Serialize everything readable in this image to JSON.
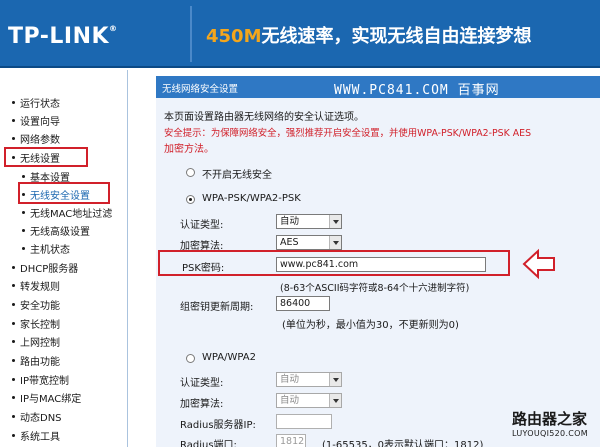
{
  "header": {
    "logo": "TP-LINK",
    "logo_reg": "®",
    "slogan_highlight": "450M",
    "slogan_text": "无线速率，实现无线自由连接梦想"
  },
  "sidebar": {
    "items": [
      {
        "label": "运行状态"
      },
      {
        "label": "设置向导"
      },
      {
        "label": "网络参数"
      },
      {
        "label": "无线设置"
      },
      {
        "label": "基本设置"
      },
      {
        "label": "无线安全设置"
      },
      {
        "label": "无线MAC地址过滤"
      },
      {
        "label": "无线高级设置"
      },
      {
        "label": "主机状态"
      },
      {
        "label": "DHCP服务器"
      },
      {
        "label": "转发规则"
      },
      {
        "label": "安全功能"
      },
      {
        "label": "家长控制"
      },
      {
        "label": "上网控制"
      },
      {
        "label": "路由功能"
      },
      {
        "label": "IP带宽控制"
      },
      {
        "label": "IP与MAC绑定"
      },
      {
        "label": "动态DNS"
      },
      {
        "label": "系统工具"
      }
    ]
  },
  "main": {
    "title": "无线网络安全设置",
    "watermark": "WWW.PC841.COM 百事网",
    "intro": "本页面设置路由器无线网络的安全认证选项。",
    "tip_line1": "安全提示：为保障网络安全，强烈推荐开启安全设置，并使用WPA-PSK/WPA2-PSK AES",
    "tip_line2": "加密方法。",
    "opt_disable": "不开启无线安全",
    "opt_wpapsk": "WPA-PSK/WPA2-PSK",
    "auth_label": "认证类型:",
    "auth_value": "自动",
    "cipher_label": "加密算法:",
    "cipher_value": "AES",
    "psk_label": "PSK密码:",
    "psk_value": "www.pc841.com",
    "psk_hint": "(8-63个ASCII码字符或8-64个十六进制字符)",
    "rekey_label": "组密钥更新周期:",
    "rekey_value": "86400",
    "rekey_hint": "(单位为秒，最小值为30，不更新则为0)",
    "opt_wpa": "WPA/WPA2",
    "wpa_auth_label": "认证类型:",
    "wpa_auth_value": "自动",
    "wpa_cipher_label": "加密算法:",
    "wpa_cipher_value": "自动",
    "radius_ip_label": "Radius服务器IP:",
    "radius_ip_value": "",
    "radius_port_label": "Radius端口:",
    "radius_port_value": "1812",
    "radius_port_hint": "(1-65535，0表示默认端口：1812)"
  },
  "bottom_logo": {
    "cn": "路由器之家",
    "en": "LUYOUQI520.COM"
  },
  "colors": {
    "header_bg": "#1b67b0",
    "titlebar_bg": "#2f78c4",
    "content_bg": "#eef3fb",
    "highlight_red": "#d1202a",
    "slogan_accent": "#f4a61c"
  }
}
